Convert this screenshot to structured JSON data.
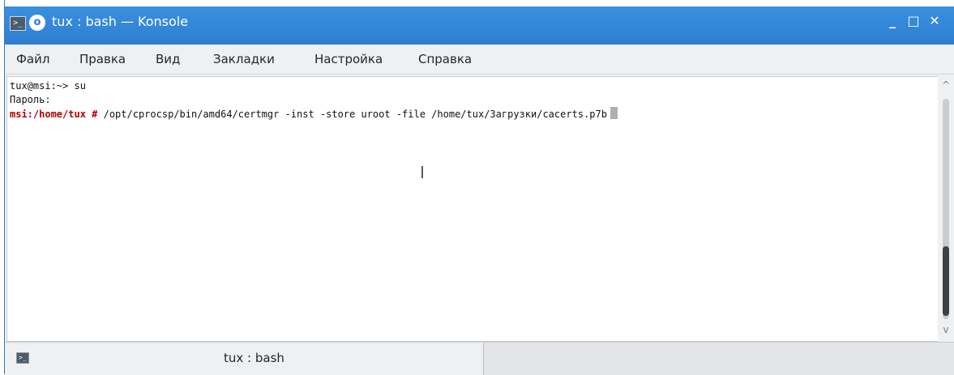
{
  "window": {
    "title": "tux : bash — Konsole",
    "terminal_icon": ">_",
    "app_icon": "konsole-icon",
    "controls": {
      "minimize": "_",
      "maximize": "□",
      "close": "✕"
    }
  },
  "menu": [
    "Файл",
    "Правка",
    "Вид",
    "Закладки",
    "Настройка",
    "Справка"
  ],
  "terminal": {
    "line1": "tux@msi:~> su",
    "line2": "Пароль:",
    "prompt": "msi:/home/tux #",
    "command": " /opt/cprocsp/bin/amd64/certmgr -inst -store uroot -file /home/tux/Загрузки/cacerts.p7b"
  },
  "scrollbar": {
    "up": "^",
    "down": "v"
  },
  "tabs": [
    {
      "label": "tux : bash",
      "icon": ">_"
    }
  ],
  "colors": {
    "titlebar": "#2f7fd0",
    "prompt": "#b00000"
  }
}
